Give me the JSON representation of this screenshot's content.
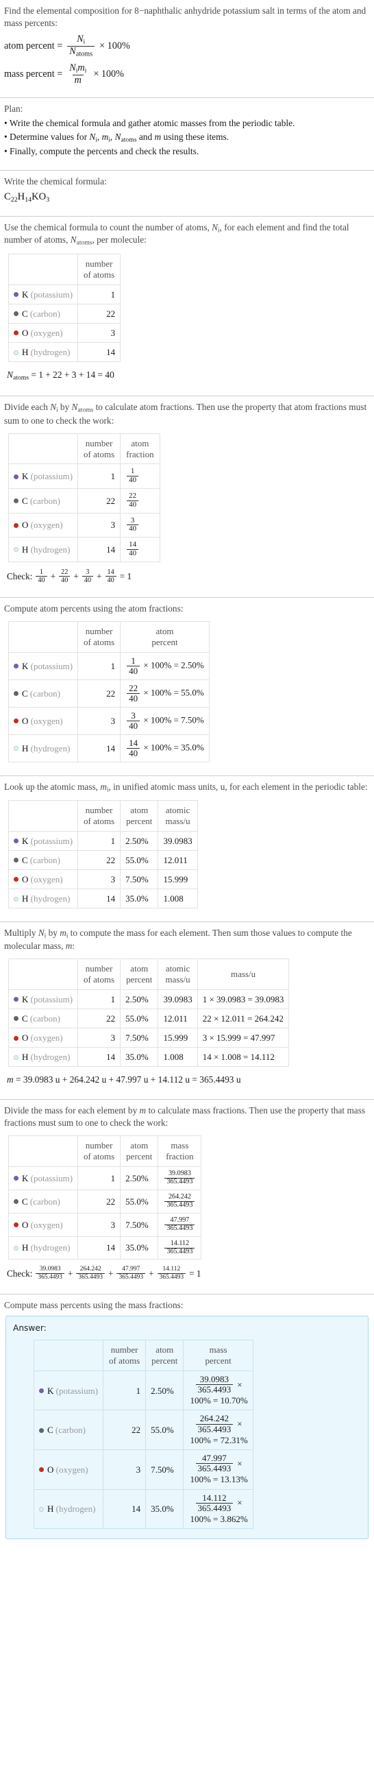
{
  "problem": {
    "statement": "Find the elemental composition for 8−naphthalic anhydride potassium salt in terms of the atom and mass percents:",
    "atom_percent_label": "atom percent =",
    "mass_percent_label": "mass percent =",
    "atom_percent_num": "N",
    "atom_percent_num_sub": "i",
    "atom_percent_den": "N",
    "atom_percent_den_sub": "atoms",
    "mass_percent_num": "N",
    "mass_percent_num_sub": "i",
    "mass_percent_num2": "m",
    "mass_percent_num2_sub": "i",
    "mass_percent_den": "m",
    "times_100": "× 100%"
  },
  "plan": {
    "heading": "Plan:",
    "items": [
      "• Write the chemical formula and gather atomic masses from the periodic table.",
      "• Determine values for Ni, mi, Natoms and m using these items.",
      "• Finally, compute the percents and check the results."
    ]
  },
  "formula_section": {
    "prompt": "Write the chemical formula:",
    "formula_parts": [
      {
        "sym": "C",
        "sub": "22"
      },
      {
        "sym": "H",
        "sub": "14"
      },
      {
        "sym": "K",
        "sub": ""
      },
      {
        "sym": "O",
        "sub": "3"
      }
    ],
    "formula_plain": "C22H14KO3"
  },
  "elements": [
    {
      "symbol": "K",
      "name": "(potassium)",
      "color": "#7a5ba8",
      "filled": true,
      "count": "1",
      "fraction_num": "1",
      "fraction_den": "40",
      "atom_percent": "2.50%",
      "atomic_mass": "39.0983",
      "mass_expr": "1 × 39.0983 = 39.0983",
      "mass_value": "39.0983",
      "mass_percent": "10.70%"
    },
    {
      "symbol": "C",
      "name": "(carbon)",
      "color": "#646464",
      "filled": true,
      "count": "22",
      "fraction_num": "22",
      "fraction_den": "40",
      "atom_percent": "55.0%",
      "atomic_mass": "12.011",
      "mass_expr": "22 × 12.011 = 264.242",
      "mass_value": "264.242",
      "mass_percent": "72.31%"
    },
    {
      "symbol": "O",
      "name": "(oxygen)",
      "color": "#c42b24",
      "filled": true,
      "count": "3",
      "fraction_num": "3",
      "fraction_den": "40",
      "atom_percent": "7.50%",
      "atomic_mass": "15.999",
      "mass_expr": "3 × 15.999 = 47.997",
      "mass_value": "47.997",
      "mass_percent": "13.13%"
    },
    {
      "symbol": "H",
      "name": "(hydrogen)",
      "color": "#d9f2f7",
      "filled": false,
      "count": "14",
      "fraction_num": "14",
      "fraction_den": "40",
      "atom_percent": "35.0%",
      "atomic_mass": "1.008",
      "mass_expr": "14 × 1.008 = 14.112",
      "mass_value": "14.112",
      "mass_percent": "3.862%"
    }
  ],
  "headers": {
    "number_of_atoms_l1": "number",
    "number_of_atoms_l2": "of atoms",
    "atom_fraction_l1": "atom",
    "atom_fraction_l2": "fraction",
    "atom_percent_l1": "atom",
    "atom_percent_l2": "percent",
    "atomic_mass_l1": "atomic",
    "atomic_mass_l2": "mass/u",
    "mass_u": "mass/u",
    "mass_fraction_l1": "mass",
    "mass_fraction_l2": "fraction",
    "mass_percent_l1": "mass",
    "mass_percent_l2": "percent"
  },
  "count_section": {
    "prompt_line1": "Use the chemical formula to count the number of atoms, Ni, for each element",
    "prompt_line2": "and find the total number of atoms, Natoms, per molecule:",
    "total_label": "N",
    "total_sub": "atoms",
    "total_expr": "= 1 + 22 + 3 + 14 = 40"
  },
  "fraction_section": {
    "prompt_line1": "Divide each Ni by Natoms to calculate atom fractions. Then use the property that",
    "prompt_line2": "atom fractions must sum to one to check the work:",
    "check_label": "Check:",
    "check_result": "= 1"
  },
  "atom_percent_section": {
    "prompt": "Compute atom percents using the atom fractions:",
    "times": "× 100% =",
    "results": [
      "2.50%",
      "55.0%",
      "7.50%",
      "35.0%"
    ]
  },
  "atomic_mass_section": {
    "prompt_line1": "Look up the atomic mass, mi, in unified atomic mass units, u, for each element in",
    "prompt_line2": "the periodic table:"
  },
  "molecular_mass_section": {
    "prompt_line1": "Multiply Ni by mi to compute the mass for each element. Then sum those values",
    "prompt_line2": "to compute the molecular mass, m:",
    "result": "m = 39.0983 u + 264.242 u + 47.997 u + 14.112 u = 365.4493 u"
  },
  "mass_fraction_section": {
    "prompt_line1": "Divide the mass for each element by m to calculate mass fractions. Then use the",
    "prompt_line2": "property that mass fractions must sum to one to check the work:",
    "denominator": "365.4493",
    "check_label": "Check:",
    "check_result": "= 1"
  },
  "mass_percent_section": {
    "prompt": "Compute mass percents using the mass fractions:",
    "answer_label": "Answer:",
    "times_symbol": "×",
    "pct_prefix": "100% ="
  }
}
